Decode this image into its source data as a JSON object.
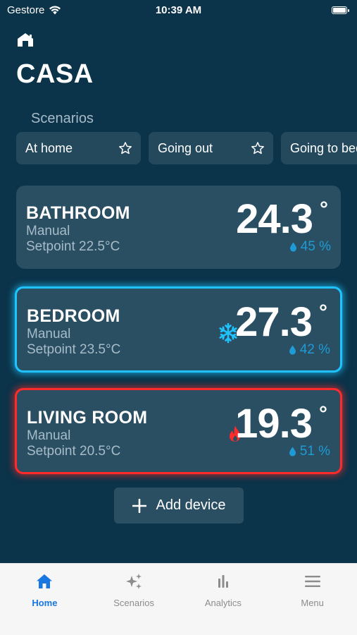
{
  "status_bar": {
    "carrier": "Gestore",
    "time": "10:39 AM"
  },
  "app": {
    "title": "CASA",
    "logo_icon": "home-logo-icon"
  },
  "scenarios": {
    "heading": "Scenarios",
    "items": [
      {
        "label": "At home",
        "icon": "star-icon"
      },
      {
        "label": "Going out",
        "icon": "star-icon"
      },
      {
        "label": "Going to bed",
        "icon": "star-icon"
      }
    ]
  },
  "devices": [
    {
      "name": "BATHROOM",
      "mode": "Manual",
      "setpoint": "Setpoint 22.5°C",
      "temperature": "24.3",
      "degree_symbol": "°",
      "humidity": "45 %",
      "state": "idle"
    },
    {
      "name": "BEDROOM",
      "mode": "Manual",
      "setpoint": "Setpoint 23.5°C",
      "temperature": "27.3",
      "degree_symbol": "°",
      "humidity": "42 %",
      "state": "cooling",
      "state_icon": "snowflake-icon",
      "accent_color": "#1ec3ff"
    },
    {
      "name": "LIVING ROOM",
      "mode": "Manual",
      "setpoint": "Setpoint 20.5°C",
      "temperature": "19.3",
      "degree_symbol": "°",
      "humidity": "51 %",
      "state": "heating",
      "state_icon": "flame-icon",
      "accent_color": "#ff2a2a"
    }
  ],
  "add_device": {
    "label": "Add device",
    "icon": "plus-icon"
  },
  "tab_bar": {
    "active": "Home",
    "active_color": "#1877e0",
    "tabs": [
      {
        "label": "Home",
        "icon": "home-icon"
      },
      {
        "label": "Scenarios",
        "icon": "sparkles-icon"
      },
      {
        "label": "Analytics",
        "icon": "bar-chart-icon"
      },
      {
        "label": "Menu",
        "icon": "menu-icon"
      }
    ]
  },
  "colors": {
    "background": "#0b3349",
    "card": "#2a4e62",
    "muted_text": "#a7bcc9",
    "humidity": "#1e9bd7"
  }
}
